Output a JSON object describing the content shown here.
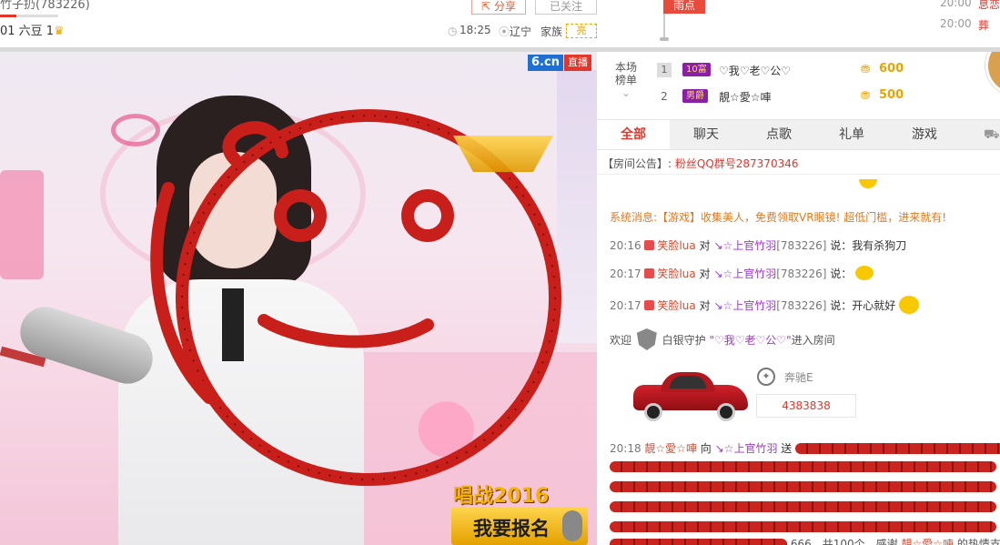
{
  "header": {
    "name_partial": "竹子扔(783226)",
    "level_text": "01 六豆 1",
    "share_label": "分享",
    "follow_label": "已关注",
    "time": "18:25",
    "location": "辽宁",
    "family_label": "家族",
    "family_badge": "亮",
    "forecast_label": "雨点",
    "right_list": [
      {
        "time": "20:00",
        "text": "息恋"
      },
      {
        "time": "20:00",
        "text": "葬"
      }
    ]
  },
  "video": {
    "brand": "6.cn",
    "live_label": "直播",
    "promo_title": "唱战2016",
    "promo_button": "我要报名"
  },
  "ranking": {
    "title": "本场榜单",
    "items": [
      {
        "rank": "1",
        "badge": "10富",
        "name": "♡我♡老♡公♡",
        "score": "600"
      },
      {
        "rank": "2",
        "badge": "男爵",
        "name": "靚☆愛☆唓",
        "score": "500"
      }
    ]
  },
  "tabs": [
    "全部",
    "聊天",
    "点歌",
    "礼单",
    "游戏"
  ],
  "notice": {
    "label": "【房间公告】:",
    "text": "粉丝QQ群号287370346"
  },
  "chat": {
    "system": "系统消息:【游戏】收集美人，免费领取VR眼镜! 超低门槛，进来就有!",
    "messages": [
      {
        "time": "20:16",
        "from": "笑脸lua",
        "verb": "对",
        "to": "↘☆上官竹羽",
        "id": "[783226]",
        "said": "说：我有杀狗刀"
      },
      {
        "time": "20:17",
        "from": "笑脸lua",
        "verb": "对",
        "to": "↘☆上官竹羽",
        "id": "[783226]",
        "said": "说："
      },
      {
        "time": "20:17",
        "from": "笑脸lua",
        "verb": "对",
        "to": "↘☆上官竹羽",
        "id": "[783226]",
        "said": "说：开心就好"
      }
    ],
    "welcome": {
      "prefix": "欢迎",
      "role": "白银守护",
      "name": "\"♡我♡老♡公♡\"",
      "suffix": "进入房间"
    },
    "car": {
      "brand": "奔驰E",
      "number": "4383838"
    },
    "gift": {
      "time": "20:18",
      "from": "靚☆愛☆唓",
      "verb": "向",
      "to": "↘☆上官竹羽",
      "action": "送",
      "tail": "666，共100个，感谢",
      "thanks_to": "靚☆愛☆唓",
      "tail2": "的热情支"
    }
  },
  "colors": {
    "accent": "#e3362a",
    "gold": "#e8a400"
  }
}
